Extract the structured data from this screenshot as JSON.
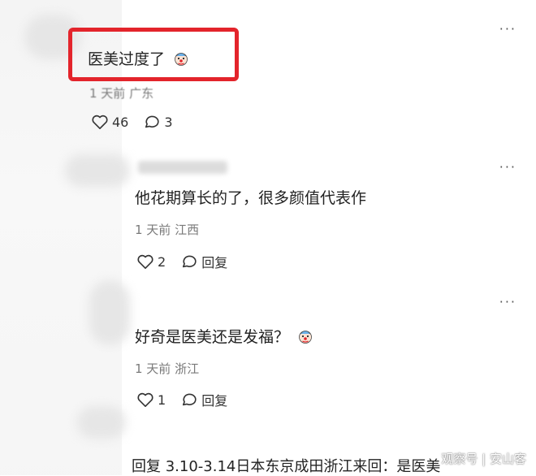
{
  "comments": [
    {
      "text": "医美过度了",
      "meta": "1 天前 广东",
      "likes": "46",
      "replies": "3"
    },
    {
      "text": "他花期算长的了，很多颜值代表作",
      "meta": "1 天前 江西",
      "likes": "2",
      "reply_label": "回复"
    },
    {
      "text": "好奇是医美还是发福？",
      "meta": "1 天前 浙江",
      "likes": "1",
      "reply_label": "回复"
    }
  ],
  "partial_comment": {
    "text": "回复 3.10-3.14日本东京成田浙江来回：是医美"
  },
  "more_label": "···",
  "watermark": "观察号 | 安山客",
  "icons": {
    "like": "heart-outline-icon",
    "reply": "speech-bubble-icon",
    "emoji": "clown-face-emoji-icon",
    "more": "more-dots-icon"
  },
  "colors": {
    "highlight": "#e3242b"
  }
}
